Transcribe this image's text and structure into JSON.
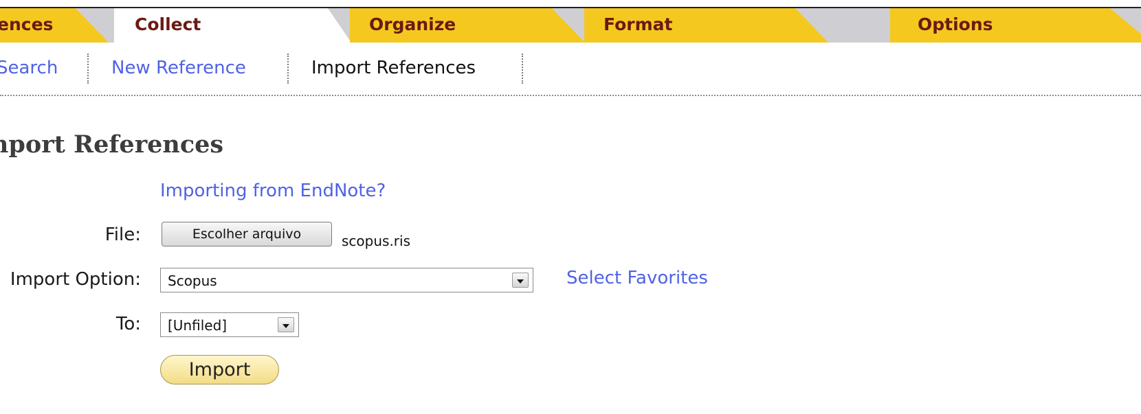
{
  "tabs": [
    {
      "label": "ences",
      "state": "inactive"
    },
    {
      "label": "Collect",
      "state": "active"
    },
    {
      "label": "Organize",
      "state": "inactive"
    },
    {
      "label": "Format",
      "state": "inactive"
    },
    {
      "label": "Options",
      "state": "inactive"
    }
  ],
  "subnav": {
    "items": [
      {
        "label": "Search",
        "current": false
      },
      {
        "label": "New Reference",
        "current": false
      },
      {
        "label": "Import References",
        "current": true
      }
    ]
  },
  "page": {
    "title": "Import References"
  },
  "form": {
    "endnote_link": "Importing from EndNote?",
    "file_label": "File:",
    "file_button": "Escolher arquivo",
    "file_name": "scopus.ris",
    "option_label": "Import Option:",
    "option_value": "Scopus",
    "favorites_link": "Select Favorites",
    "to_label": "To:",
    "to_value": "[Unfiled]",
    "import_button": "Import"
  },
  "colors": {
    "tab_yellow": "#f4c81f",
    "tab_text": "#6b1a13",
    "link": "#4f62e5",
    "tabbar_bg": "#cfcfd3"
  }
}
